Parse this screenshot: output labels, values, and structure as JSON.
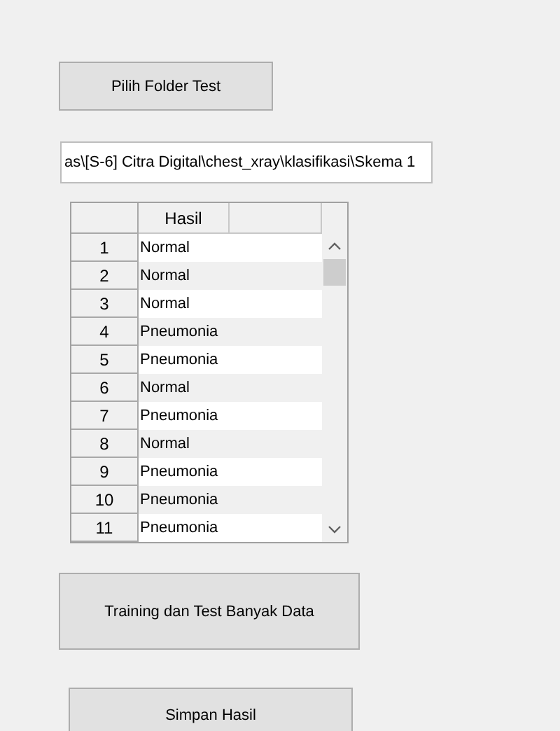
{
  "folder_button": {
    "label": "Pilih Folder Test"
  },
  "path_field": {
    "value": "as\\[S-6] Citra Digital\\chest_xray\\klasifikasi\\Skema 1"
  },
  "table": {
    "columns": [
      "Hasil"
    ],
    "rows": [
      {
        "number": "1",
        "hasil": "Normal"
      },
      {
        "number": "2",
        "hasil": "Normal"
      },
      {
        "number": "3",
        "hasil": "Normal"
      },
      {
        "number": "4",
        "hasil": "Pneumonia"
      },
      {
        "number": "5",
        "hasil": "Pneumonia"
      },
      {
        "number": "6",
        "hasil": "Normal"
      },
      {
        "number": "7",
        "hasil": "Pneumonia"
      },
      {
        "number": "8",
        "hasil": "Normal"
      },
      {
        "number": "9",
        "hasil": "Pneumonia"
      },
      {
        "number": "10",
        "hasil": "Pneumonia"
      },
      {
        "number": "11",
        "hasil": "Pneumonia"
      }
    ]
  },
  "train_button": {
    "label": "Training dan Test Banyak Data"
  },
  "save_button": {
    "label": "Simpan Hasil"
  }
}
